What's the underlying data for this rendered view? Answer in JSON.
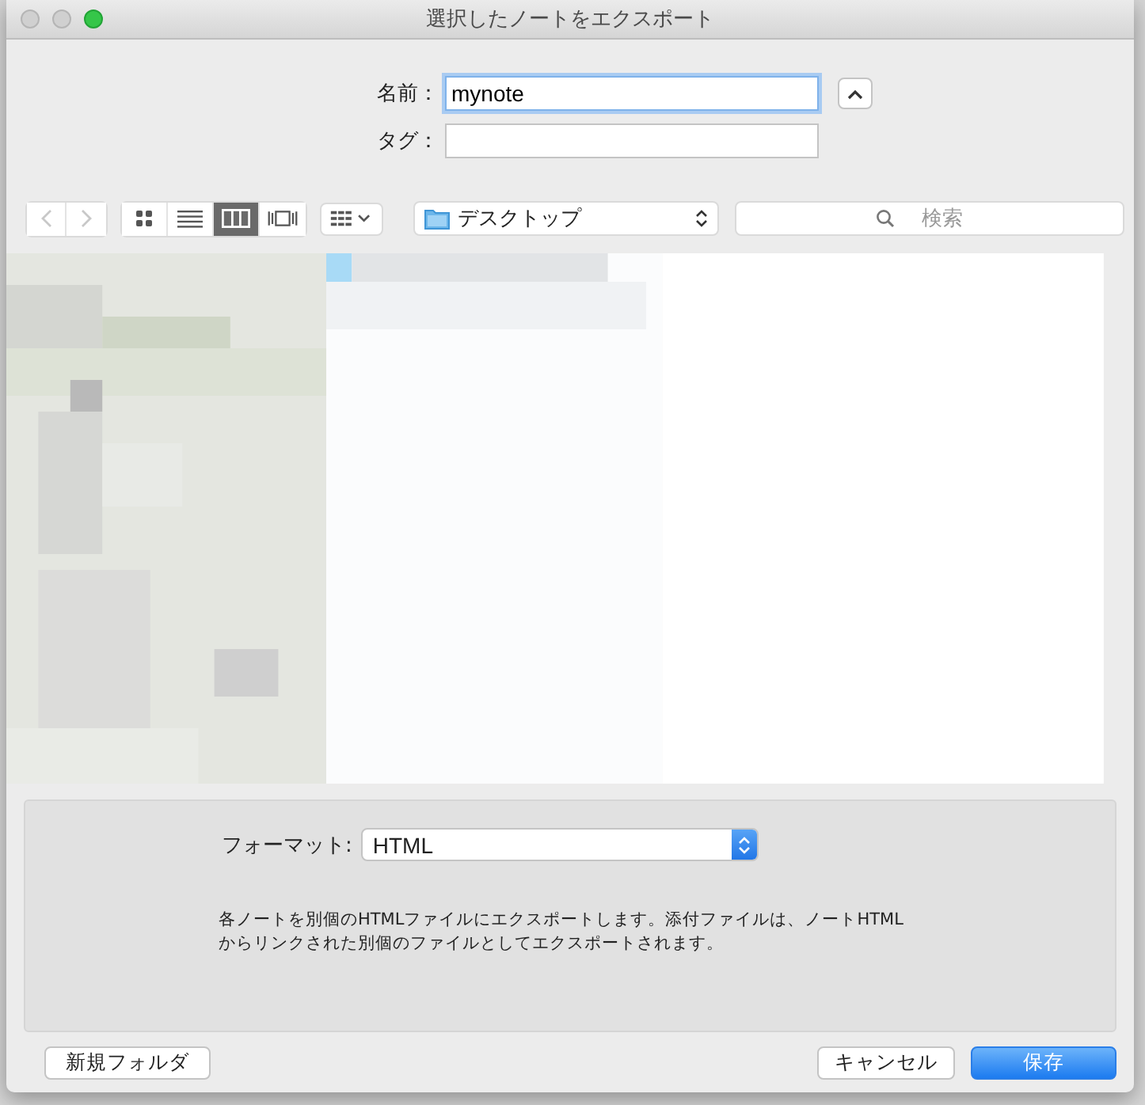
{
  "window": {
    "title": "選択したノートをエクスポート"
  },
  "name_field": {
    "label": "名前：",
    "value": "mynote"
  },
  "tag_field": {
    "label": "タグ："
  },
  "toolbar": {
    "views": [
      {
        "kind": "icons",
        "selected": false
      },
      {
        "kind": "list",
        "selected": false
      },
      {
        "kind": "columns",
        "selected": true
      },
      {
        "kind": "coverflow",
        "selected": false
      }
    ],
    "location": "デスクトップ",
    "search": {
      "placeholder": "検索"
    }
  },
  "options": {
    "format_label": "フォーマット:",
    "format_value": "HTML",
    "description": "各ノートを別個のHTMLファイルにエクスポートします。添付ファイルは、ノートHTMLからリンクされた別個のファイルとしてエクスポートされます。"
  },
  "buttons": [
    {
      "label": "新規フォルダ",
      "kind": "plain"
    },
    {
      "label": "キャンセル",
      "kind": "plain"
    },
    {
      "label": "保存",
      "kind": "default"
    }
  ]
}
